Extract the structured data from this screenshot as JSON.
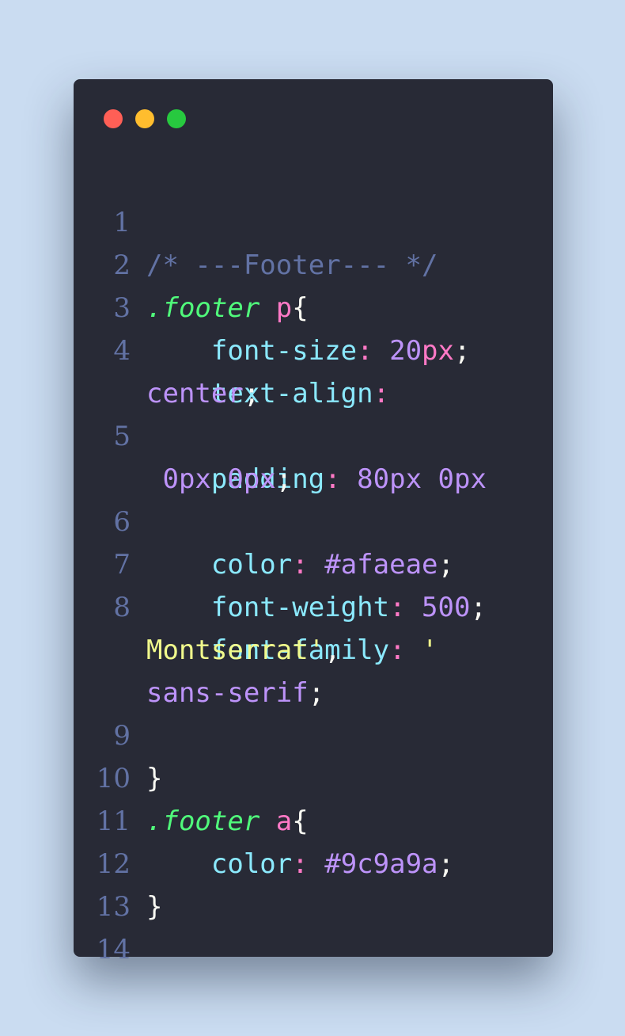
{
  "window": {
    "dots": [
      "close",
      "minimize",
      "maximize"
    ]
  },
  "colors": {
    "background": "#cadcf1",
    "editor": "#282a36",
    "line_number": "#6272a4",
    "comment": "#6272a4",
    "selector": "#50fa7b",
    "tag": "#ff79c6",
    "property": "#8be9fd",
    "value": "#bd93f9",
    "string": "#f1fa8c",
    "text": "#f8f8f2"
  },
  "code": {
    "line_numbers": [
      "1",
      "2",
      "3",
      "4",
      "5",
      "6",
      "7",
      "8",
      "9",
      "10",
      "11",
      "12",
      "13",
      "14"
    ],
    "l1_comment": "/* ---Footer--- */",
    "l2_selector": ".footer",
    "l2_tag": "p",
    "l2_brace": "{",
    "l3_prop": "font-size",
    "l3_colon": ":",
    "l3_num": "20",
    "l3_unit": "px",
    "l3_semi": ";",
    "l4_prop": "text-align",
    "l4_colon": ":",
    "l4_value": "center",
    "l4_semi": ";",
    "l5_prop": "padding",
    "l5_colon": ":",
    "l5_value_a": "80px 0px",
    "l5_value_b": "0px 0px",
    "l5_semi": ";",
    "l6_prop": "color",
    "l6_colon": ":",
    "l6_value": "#afaeae",
    "l6_semi": ";",
    "l7_prop": "font-weight",
    "l7_colon": ":",
    "l7_value": "500",
    "l7_semi": ";",
    "l8_prop": "font-family",
    "l8_colon": ":",
    "l8_quote": "'",
    "l8_string": "Montserrat'",
    "l8_comma": ",",
    "l8_value": "sans-serif",
    "l8_semi": ";",
    "l9_brace": "}",
    "l10_selector": ".footer",
    "l10_tag": "a",
    "l10_brace": "{",
    "l11_prop": "color",
    "l11_colon": ":",
    "l11_value": "#9c9a9a",
    "l11_semi": ";",
    "l12_brace": "}"
  }
}
